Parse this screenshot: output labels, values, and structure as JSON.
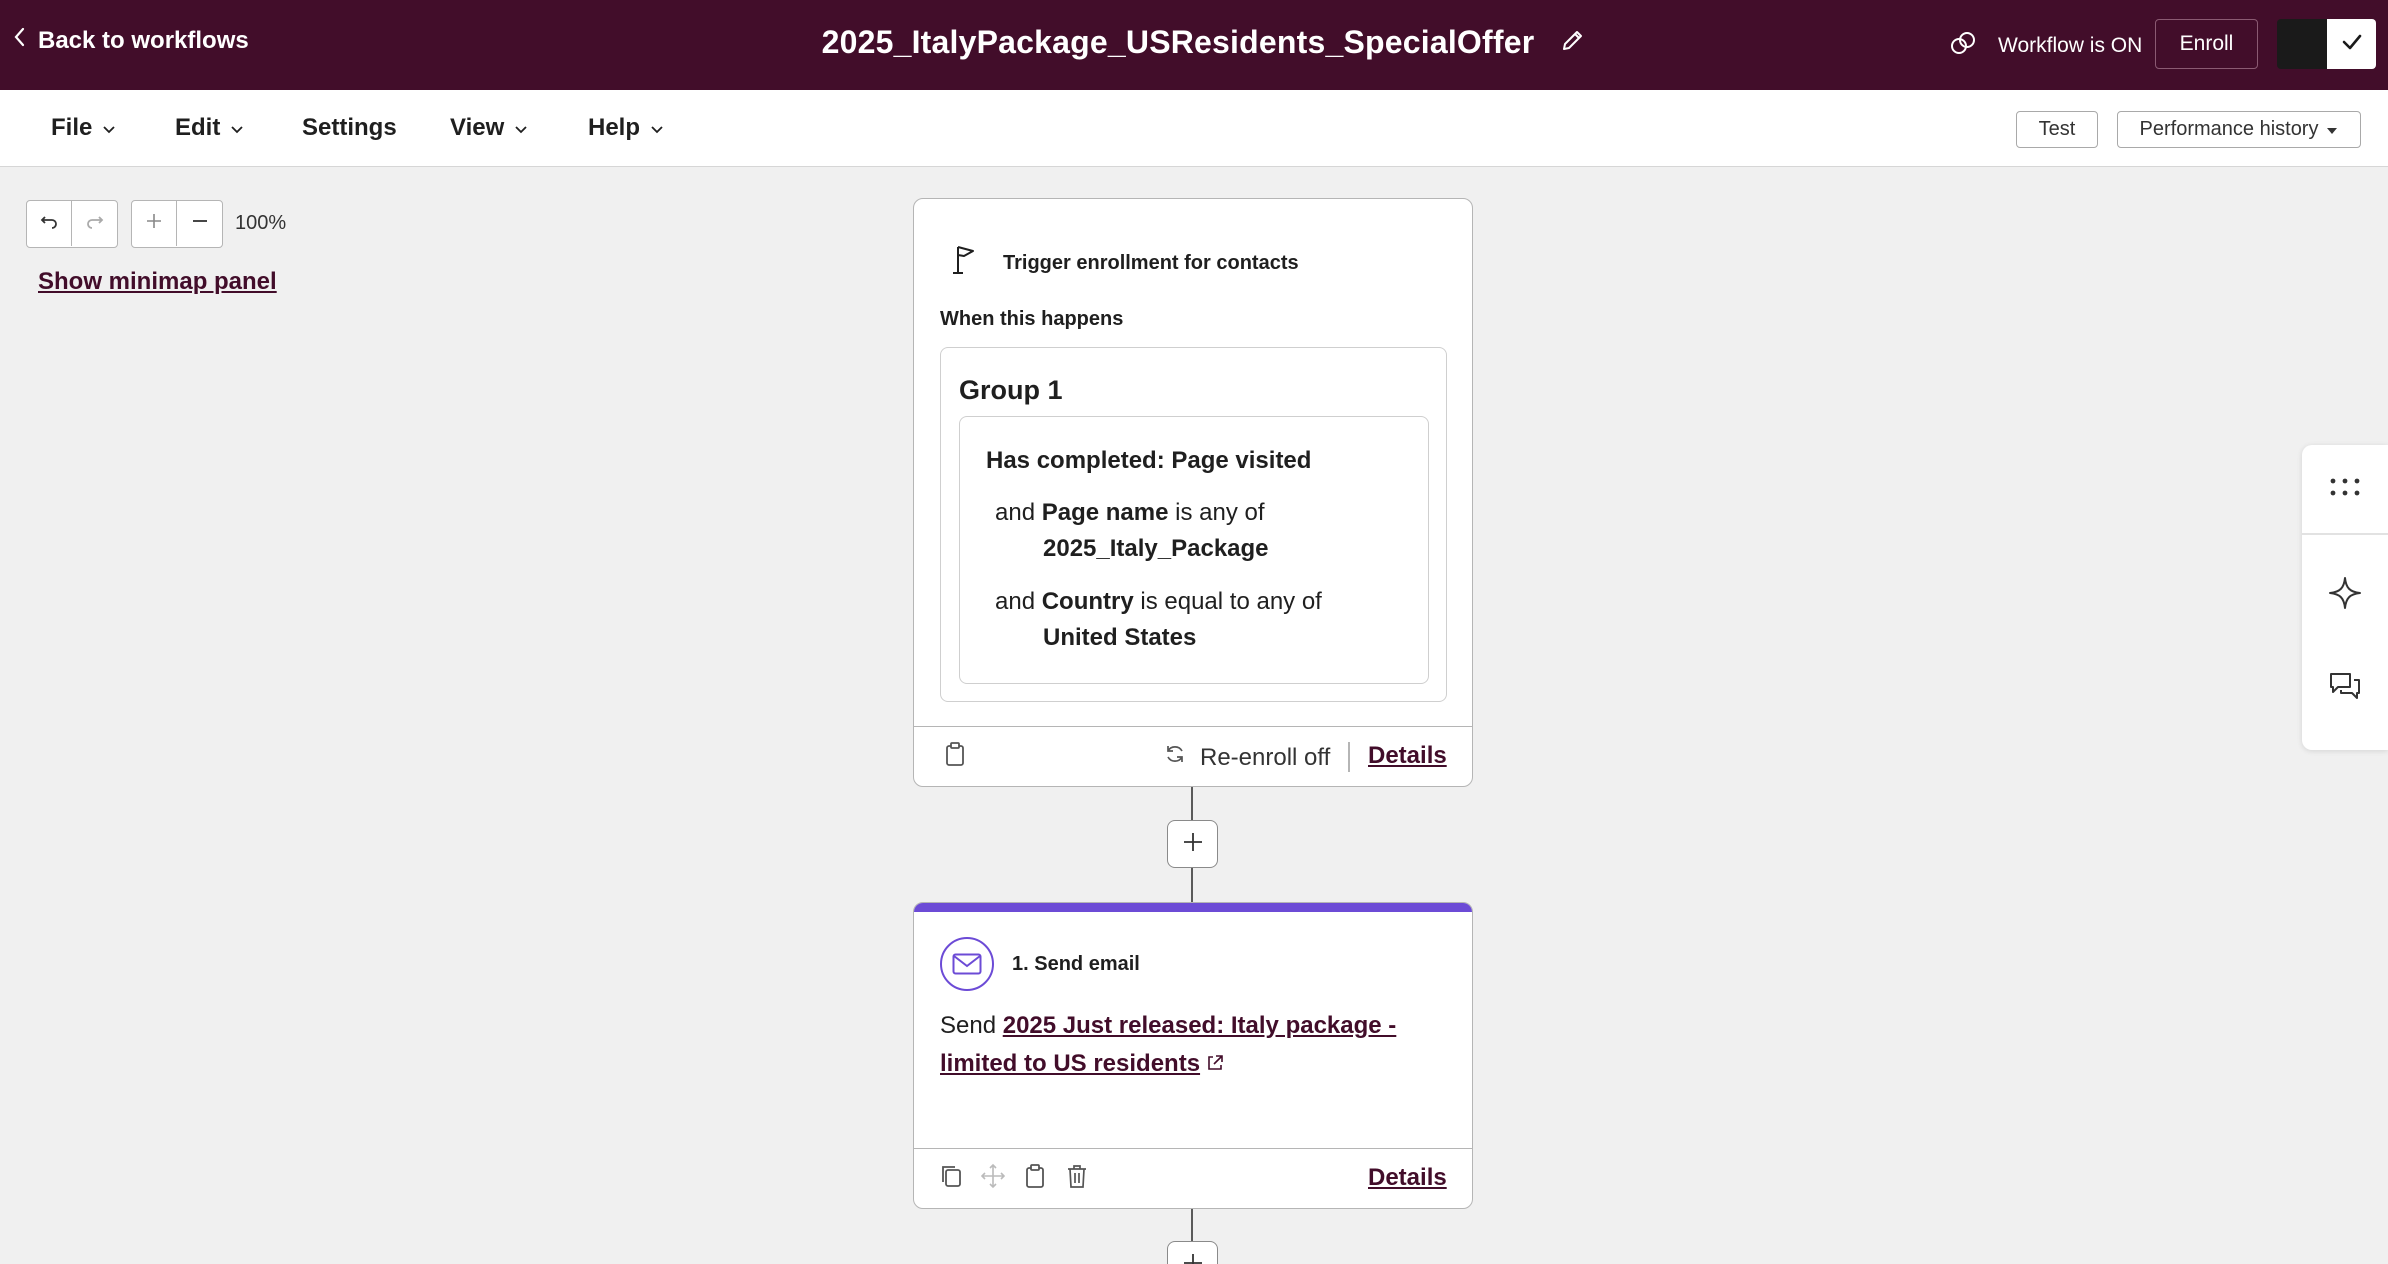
{
  "header": {
    "back_label": "Back to workflows",
    "workflow_title": "2025_ItalyPackage_USResidents_SpecialOffer",
    "status_label": "Workflow is ON",
    "enroll_label": "Enroll",
    "colors": {
      "header_bg": "#420d2a",
      "accent": "#6c4bd6"
    }
  },
  "menu": {
    "items": [
      {
        "label": "File"
      },
      {
        "label": "Edit"
      },
      {
        "label": "Settings"
      },
      {
        "label": "View"
      },
      {
        "label": "Help"
      }
    ],
    "test_label": "Test",
    "performance_label": "Performance history"
  },
  "canvas": {
    "zoom": "100%",
    "minimap_label": "Show minimap panel"
  },
  "trigger": {
    "title": "Trigger enrollment for contacts",
    "when_label": "When this happens",
    "group_title": "Group 1",
    "criteria_title": "Has completed: Page visited",
    "conditions": [
      {
        "prefix": "and",
        "property": "Page name",
        "operator": "is any of",
        "value": "2025_Italy_Package"
      },
      {
        "prefix": "and",
        "property": "Country",
        "operator": "is equal to any of",
        "value": "United States"
      }
    ],
    "reenroll_label": "Re-enroll off",
    "details_label": "Details"
  },
  "action": {
    "title": "1. Send email",
    "send_prefix": "Send",
    "email_name": "2025 Just released: Italy package - limited to US residents",
    "details_label": "Details"
  },
  "icons": {
    "side_panel": [
      "grid-dots-icon",
      "sparkle-icon",
      "comments-icon"
    ]
  }
}
